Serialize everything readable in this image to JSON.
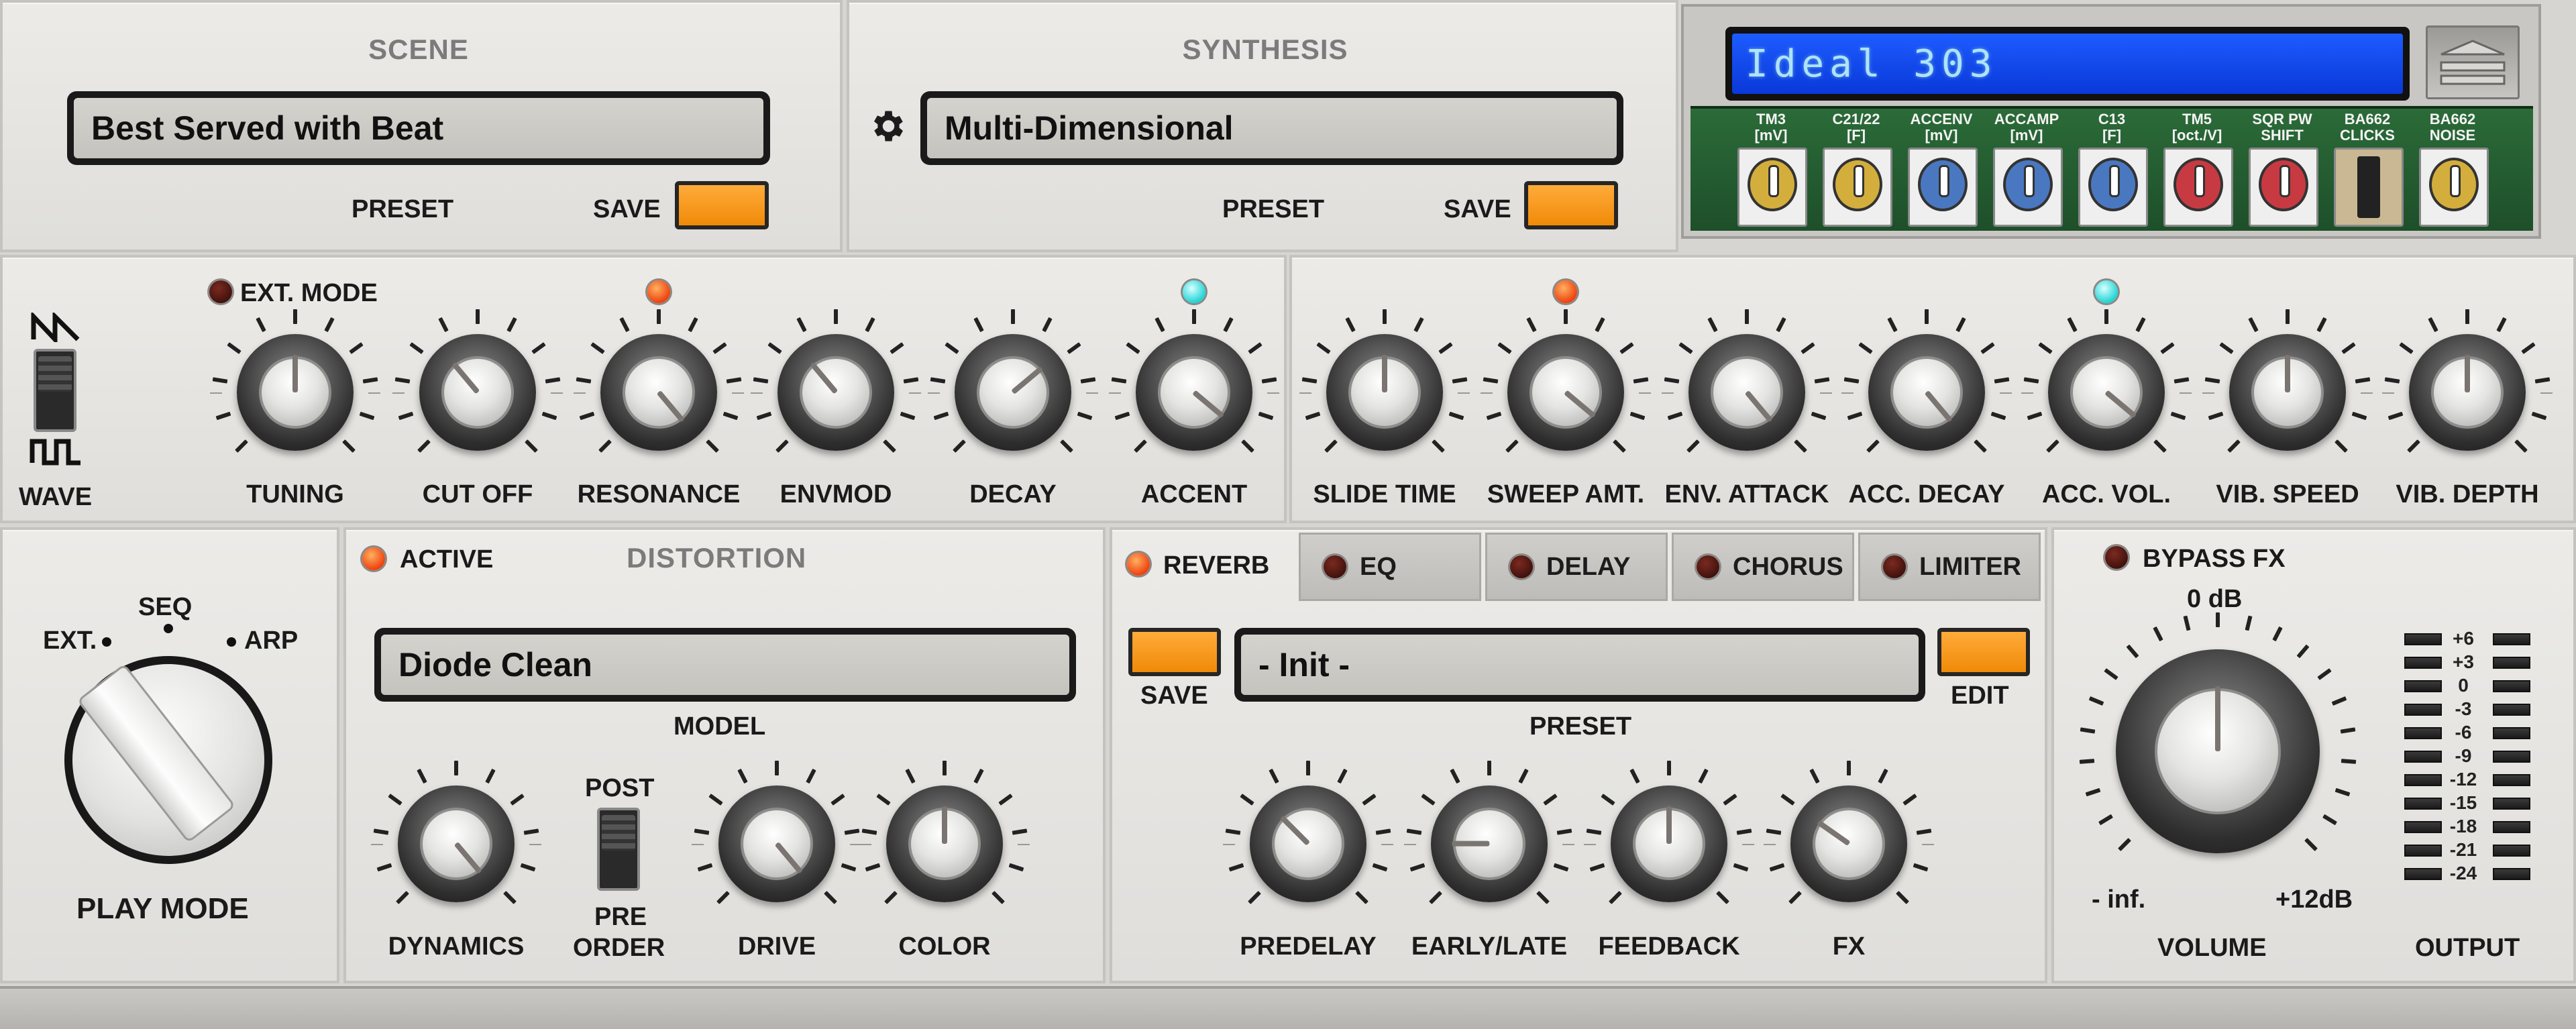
{
  "scene": {
    "title": "SCENE",
    "preset_name": "Best Served with Beat",
    "preset_label": "PRESET",
    "save_label": "SAVE"
  },
  "synthesis": {
    "title": "SYNTHESIS",
    "preset_name": "Multi-Dimensional",
    "preset_label": "PRESET",
    "save_label": "SAVE",
    "settings_icon": "gear-icon"
  },
  "hardware": {
    "display_text": "Ideal 303",
    "trimmers": [
      {
        "label": "TM3\n[mV]",
        "color": "#d4ae3c"
      },
      {
        "label": "C21/22\n[F]",
        "color": "#d4ae3c"
      },
      {
        "label": "ACCENV\n[mV]",
        "color": "#4a78c0"
      },
      {
        "label": "ACCAMP\n[mV]",
        "color": "#4a78c0"
      },
      {
        "label": "C13\n[F]",
        "color": "#4a78c0"
      },
      {
        "label": "TM5\n[oct./V]",
        "color": "#c83a42"
      },
      {
        "label": "SQR PW\nSHIFT",
        "color": "#c83a42"
      },
      {
        "label": "BA662\nCLICKS",
        "color": "switch"
      },
      {
        "label": "BA662\nNOISE",
        "color": "#d4ae3c"
      }
    ]
  },
  "synth": {
    "wave_label": "WAVE",
    "ext_mode_label": "EXT. MODE",
    "knobs_left": [
      "TUNING",
      "CUT OFF",
      "RESONANCE",
      "ENVMOD",
      "DECAY",
      "ACCENT"
    ],
    "knobs_right": [
      "SLIDE TIME",
      "SWEEP AMT.",
      "ENV. ATTACK",
      "ACC. DECAY",
      "ACC. VOL.",
      "VIB. SPEED",
      "VIB. DEPTH"
    ]
  },
  "play_mode": {
    "title": "PLAY MODE",
    "options": [
      "EXT.",
      "SEQ",
      "ARP"
    ]
  },
  "distortion": {
    "title": "DISTORTION",
    "active_label": "ACTIVE",
    "model_name": "Diode Clean",
    "model_label": "MODEL",
    "knobs": [
      "DYNAMICS",
      "DRIVE",
      "COLOR"
    ],
    "order": {
      "label": "ORDER",
      "post": "POST",
      "pre": "PRE"
    }
  },
  "fx": {
    "tabs": [
      "REVERB",
      "EQ",
      "DELAY",
      "CHORUS",
      "LIMITER"
    ],
    "save_label": "SAVE",
    "preset_name": "- Init -",
    "preset_label": "PRESET",
    "edit_label": "EDIT",
    "knobs": [
      "PREDELAY",
      "EARLY/LATE",
      "FEEDBACK",
      "FX"
    ]
  },
  "output": {
    "bypass_label": "BYPASS FX",
    "volume_label": "VOLUME",
    "vol_top": "0 dB",
    "vol_min": "- inf.",
    "vol_max": "+12dB",
    "output_label": "OUTPUT",
    "meter_scale": [
      "+6",
      "+3",
      "0",
      "-3",
      "-6",
      "-9",
      "-12",
      "-15",
      "-18",
      "-21",
      "-24"
    ]
  }
}
